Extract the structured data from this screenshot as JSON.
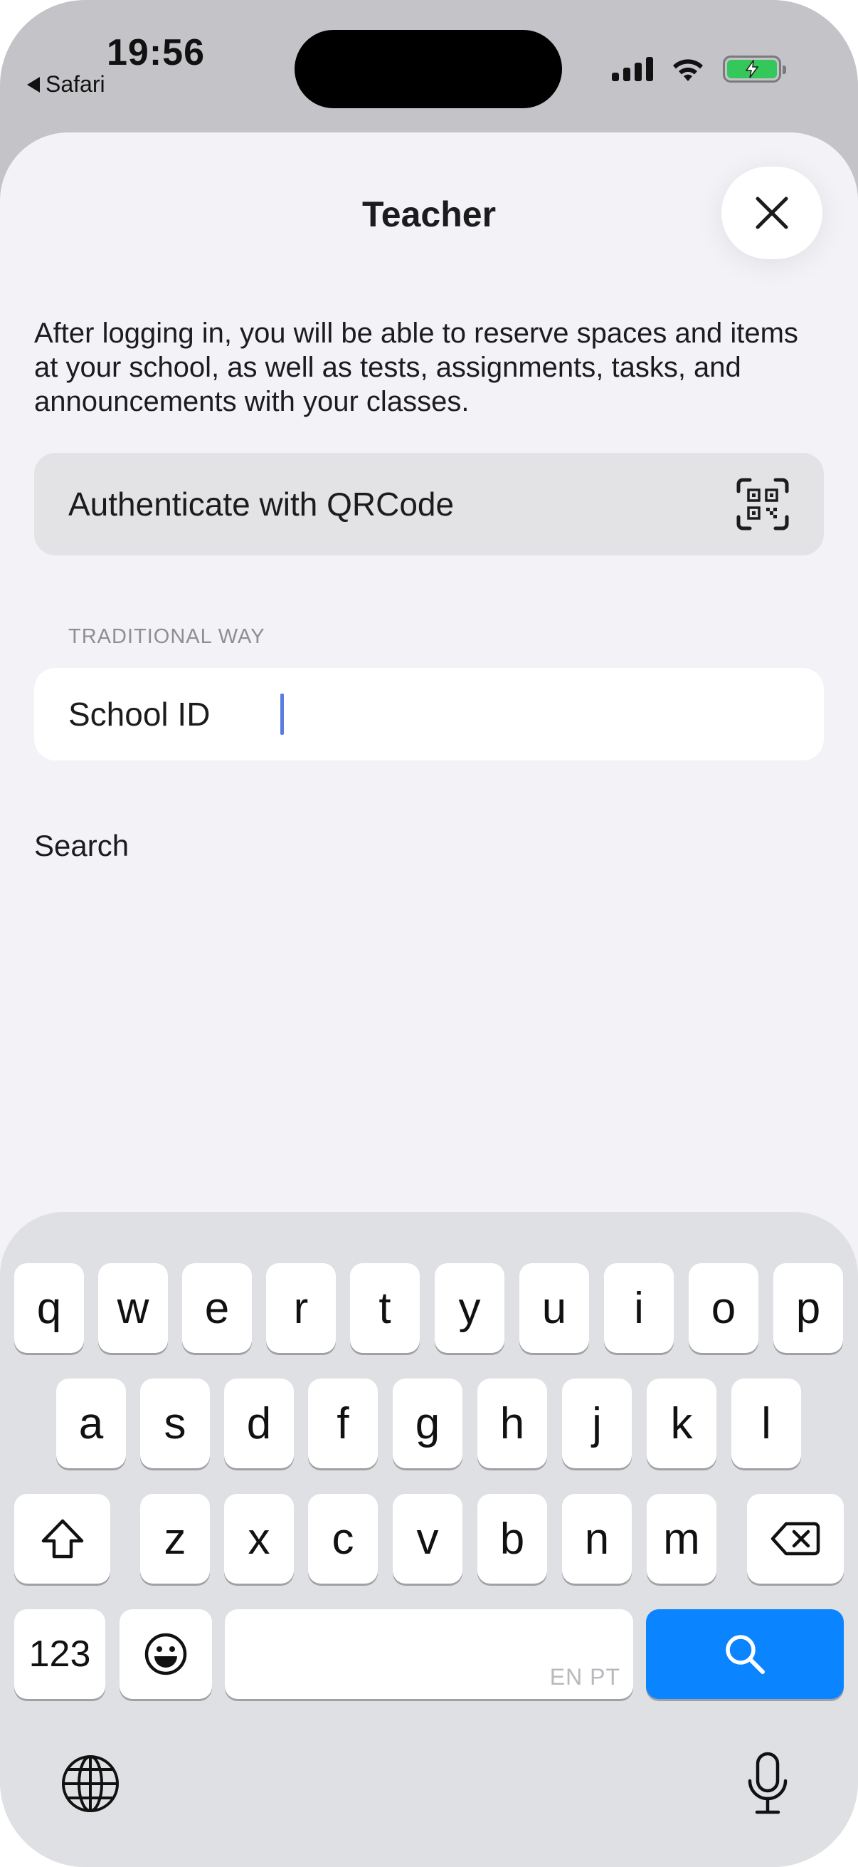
{
  "status_bar": {
    "time": "19:56",
    "back_label": "Safari"
  },
  "sheet": {
    "title": "Teacher",
    "description": "After logging in, you will be able to reserve spaces and items at your school, as well as tests, assignments, tasks, and announcements with your classes.",
    "qr_button_label": "Authenticate with QRCode",
    "section_header": "TRADITIONAL WAY",
    "school_id_label": "School ID",
    "school_id_value": "",
    "search_label": "Search"
  },
  "keyboard": {
    "row1": [
      "q",
      "w",
      "e",
      "r",
      "t",
      "y",
      "u",
      "i",
      "o",
      "p"
    ],
    "row2": [
      "a",
      "s",
      "d",
      "f",
      "g",
      "h",
      "j",
      "k",
      "l"
    ],
    "row3": [
      "z",
      "x",
      "c",
      "v",
      "b",
      "n",
      "m"
    ],
    "numbers_label": "123",
    "space_hint": "EN PT"
  },
  "colors": {
    "accent": "#0a84ff",
    "battery": "#34c759",
    "caret": "#5b7de0"
  },
  "icons": [
    "back-triangle-icon",
    "signal-icon",
    "wifi-icon",
    "battery-charging-icon",
    "close-icon",
    "qr-code-icon",
    "shift-icon",
    "backspace-icon",
    "emoji-icon",
    "search-icon",
    "globe-icon",
    "microphone-icon"
  ]
}
